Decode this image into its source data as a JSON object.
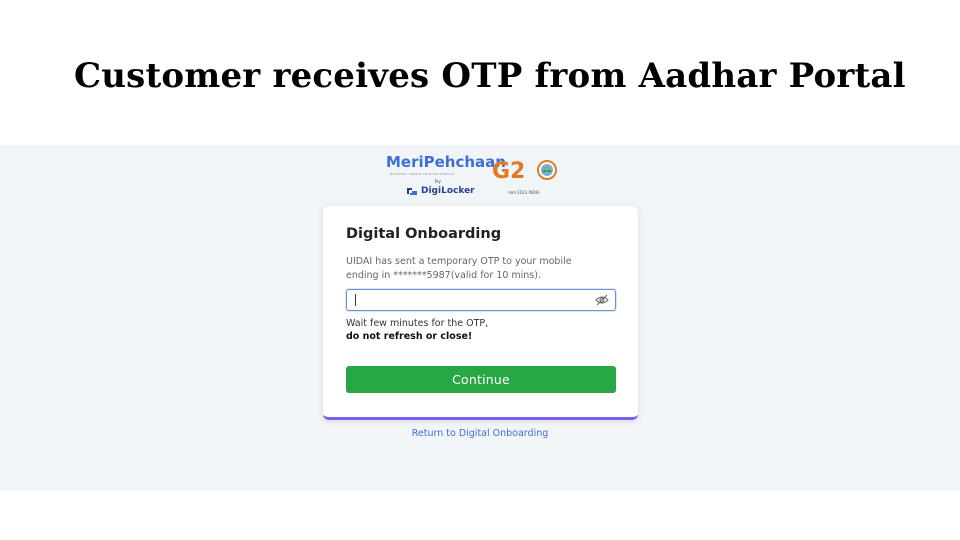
{
  "slide": {
    "title": "Customer receives OTP from Aadhar Portal"
  },
  "branding": {
    "meripehchaan": "MeriPehchaan",
    "meripehchaan_tagline": "NATIONAL SINGLE SIGN-ON SERVICE",
    "by": "by",
    "digilocker": "DigiLocker",
    "g20": "G2",
    "g20_tagline": "भारत 2023 INDIA"
  },
  "card": {
    "title": "Digital Onboarding",
    "message": "UIDAI has sent a temporary OTP to your mobile ending in *******5987(valid for 10 mins).",
    "otp_input": {
      "value": "",
      "placeholder": ""
    },
    "wait_text": "Wait few minutes for the OTP,",
    "wait_bold": "do not refresh or close!",
    "continue_label": "Continue"
  },
  "footer": {
    "return_link": "Return to Digital Onboarding"
  },
  "colors": {
    "brand_blue": "#3d6fd6",
    "g20_orange": "#e07a25",
    "continue_green": "#28a745",
    "card_accent": "#7b5cf0",
    "link_blue": "#3a6fd8",
    "page_bg": "#f2f5f7"
  },
  "icons": {
    "password_toggle": "eye-slash-icon",
    "digilocker": "digilocker-icon",
    "g20": "globe-lotus-icon"
  }
}
